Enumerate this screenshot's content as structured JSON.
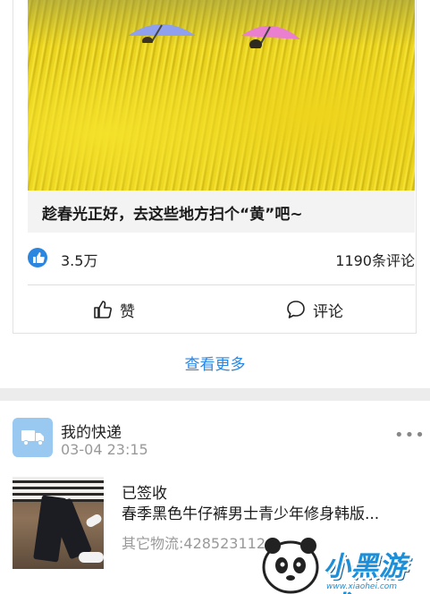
{
  "article": {
    "title": "趁春光正好，去这些地方扫个“黄”吧~",
    "likes": "3.5万",
    "comments": "1190条评论"
  },
  "actions": {
    "like_label": "赞",
    "comment_label": "评论"
  },
  "see_more": "查看更多",
  "package": {
    "title": "我的快递",
    "time": "03-04 23:15",
    "status": "已签收",
    "product": "春季黑色牛仔裤男士青少年修身韩版...",
    "tracking": "其它物流:4285231124"
  },
  "watermark": {
    "brand": "小黑游戏",
    "url": "www.xiaohei.com"
  },
  "colors": {
    "accent": "#2b86e0",
    "package_icon_bg": "#99c8f1",
    "section_gap": "#ececec"
  },
  "icons": [
    "like-badge-icon",
    "thumbs-up-icon",
    "comment-bubble-icon",
    "truck-icon",
    "more-dots-icon"
  ]
}
